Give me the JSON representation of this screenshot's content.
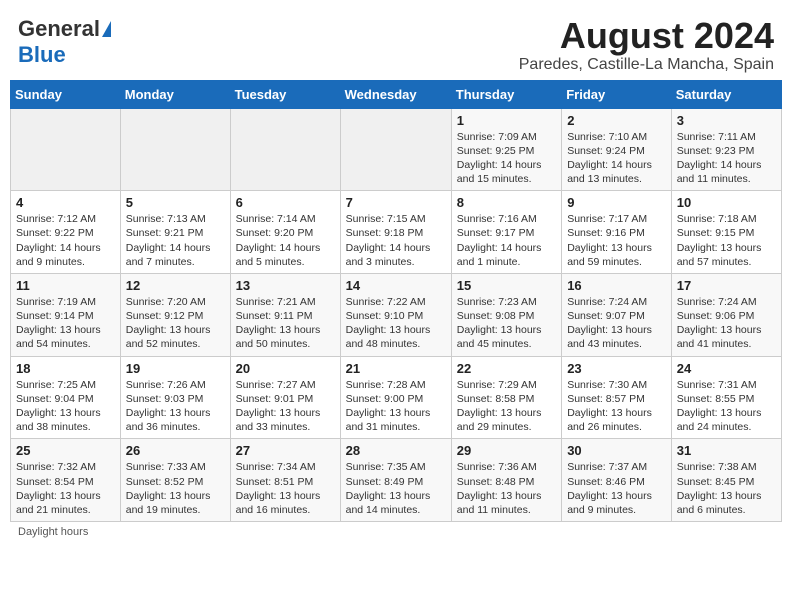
{
  "header": {
    "logo_general": "General",
    "logo_blue": "Blue",
    "title": "August 2024",
    "subtitle": "Paredes, Castille-La Mancha, Spain"
  },
  "weekdays": [
    "Sunday",
    "Monday",
    "Tuesday",
    "Wednesday",
    "Thursday",
    "Friday",
    "Saturday"
  ],
  "weeks": [
    [
      {
        "day": "",
        "sunrise": "",
        "sunset": "",
        "daylight": ""
      },
      {
        "day": "",
        "sunrise": "",
        "sunset": "",
        "daylight": ""
      },
      {
        "day": "",
        "sunrise": "",
        "sunset": "",
        "daylight": ""
      },
      {
        "day": "",
        "sunrise": "",
        "sunset": "",
        "daylight": ""
      },
      {
        "day": "1",
        "sunrise": "Sunrise: 7:09 AM",
        "sunset": "Sunset: 9:25 PM",
        "daylight": "Daylight: 14 hours and 15 minutes."
      },
      {
        "day": "2",
        "sunrise": "Sunrise: 7:10 AM",
        "sunset": "Sunset: 9:24 PM",
        "daylight": "Daylight: 14 hours and 13 minutes."
      },
      {
        "day": "3",
        "sunrise": "Sunrise: 7:11 AM",
        "sunset": "Sunset: 9:23 PM",
        "daylight": "Daylight: 14 hours and 11 minutes."
      }
    ],
    [
      {
        "day": "4",
        "sunrise": "Sunrise: 7:12 AM",
        "sunset": "Sunset: 9:22 PM",
        "daylight": "Daylight: 14 hours and 9 minutes."
      },
      {
        "day": "5",
        "sunrise": "Sunrise: 7:13 AM",
        "sunset": "Sunset: 9:21 PM",
        "daylight": "Daylight: 14 hours and 7 minutes."
      },
      {
        "day": "6",
        "sunrise": "Sunrise: 7:14 AM",
        "sunset": "Sunset: 9:20 PM",
        "daylight": "Daylight: 14 hours and 5 minutes."
      },
      {
        "day": "7",
        "sunrise": "Sunrise: 7:15 AM",
        "sunset": "Sunset: 9:18 PM",
        "daylight": "Daylight: 14 hours and 3 minutes."
      },
      {
        "day": "8",
        "sunrise": "Sunrise: 7:16 AM",
        "sunset": "Sunset: 9:17 PM",
        "daylight": "Daylight: 14 hours and 1 minute."
      },
      {
        "day": "9",
        "sunrise": "Sunrise: 7:17 AM",
        "sunset": "Sunset: 9:16 PM",
        "daylight": "Daylight: 13 hours and 59 minutes."
      },
      {
        "day": "10",
        "sunrise": "Sunrise: 7:18 AM",
        "sunset": "Sunset: 9:15 PM",
        "daylight": "Daylight: 13 hours and 57 minutes."
      }
    ],
    [
      {
        "day": "11",
        "sunrise": "Sunrise: 7:19 AM",
        "sunset": "Sunset: 9:14 PM",
        "daylight": "Daylight: 13 hours and 54 minutes."
      },
      {
        "day": "12",
        "sunrise": "Sunrise: 7:20 AM",
        "sunset": "Sunset: 9:12 PM",
        "daylight": "Daylight: 13 hours and 52 minutes."
      },
      {
        "day": "13",
        "sunrise": "Sunrise: 7:21 AM",
        "sunset": "Sunset: 9:11 PM",
        "daylight": "Daylight: 13 hours and 50 minutes."
      },
      {
        "day": "14",
        "sunrise": "Sunrise: 7:22 AM",
        "sunset": "Sunset: 9:10 PM",
        "daylight": "Daylight: 13 hours and 48 minutes."
      },
      {
        "day": "15",
        "sunrise": "Sunrise: 7:23 AM",
        "sunset": "Sunset: 9:08 PM",
        "daylight": "Daylight: 13 hours and 45 minutes."
      },
      {
        "day": "16",
        "sunrise": "Sunrise: 7:24 AM",
        "sunset": "Sunset: 9:07 PM",
        "daylight": "Daylight: 13 hours and 43 minutes."
      },
      {
        "day": "17",
        "sunrise": "Sunrise: 7:24 AM",
        "sunset": "Sunset: 9:06 PM",
        "daylight": "Daylight: 13 hours and 41 minutes."
      }
    ],
    [
      {
        "day": "18",
        "sunrise": "Sunrise: 7:25 AM",
        "sunset": "Sunset: 9:04 PM",
        "daylight": "Daylight: 13 hours and 38 minutes."
      },
      {
        "day": "19",
        "sunrise": "Sunrise: 7:26 AM",
        "sunset": "Sunset: 9:03 PM",
        "daylight": "Daylight: 13 hours and 36 minutes."
      },
      {
        "day": "20",
        "sunrise": "Sunrise: 7:27 AM",
        "sunset": "Sunset: 9:01 PM",
        "daylight": "Daylight: 13 hours and 33 minutes."
      },
      {
        "day": "21",
        "sunrise": "Sunrise: 7:28 AM",
        "sunset": "Sunset: 9:00 PM",
        "daylight": "Daylight: 13 hours and 31 minutes."
      },
      {
        "day": "22",
        "sunrise": "Sunrise: 7:29 AM",
        "sunset": "Sunset: 8:58 PM",
        "daylight": "Daylight: 13 hours and 29 minutes."
      },
      {
        "day": "23",
        "sunrise": "Sunrise: 7:30 AM",
        "sunset": "Sunset: 8:57 PM",
        "daylight": "Daylight: 13 hours and 26 minutes."
      },
      {
        "day": "24",
        "sunrise": "Sunrise: 7:31 AM",
        "sunset": "Sunset: 8:55 PM",
        "daylight": "Daylight: 13 hours and 24 minutes."
      }
    ],
    [
      {
        "day": "25",
        "sunrise": "Sunrise: 7:32 AM",
        "sunset": "Sunset: 8:54 PM",
        "daylight": "Daylight: 13 hours and 21 minutes."
      },
      {
        "day": "26",
        "sunrise": "Sunrise: 7:33 AM",
        "sunset": "Sunset: 8:52 PM",
        "daylight": "Daylight: 13 hours and 19 minutes."
      },
      {
        "day": "27",
        "sunrise": "Sunrise: 7:34 AM",
        "sunset": "Sunset: 8:51 PM",
        "daylight": "Daylight: 13 hours and 16 minutes."
      },
      {
        "day": "28",
        "sunrise": "Sunrise: 7:35 AM",
        "sunset": "Sunset: 8:49 PM",
        "daylight": "Daylight: 13 hours and 14 minutes."
      },
      {
        "day": "29",
        "sunrise": "Sunrise: 7:36 AM",
        "sunset": "Sunset: 8:48 PM",
        "daylight": "Daylight: 13 hours and 11 minutes."
      },
      {
        "day": "30",
        "sunrise": "Sunrise: 7:37 AM",
        "sunset": "Sunset: 8:46 PM",
        "daylight": "Daylight: 13 hours and 9 minutes."
      },
      {
        "day": "31",
        "sunrise": "Sunrise: 7:38 AM",
        "sunset": "Sunset: 8:45 PM",
        "daylight": "Daylight: 13 hours and 6 minutes."
      }
    ]
  ],
  "footer": {
    "daylight_label": "Daylight hours"
  }
}
